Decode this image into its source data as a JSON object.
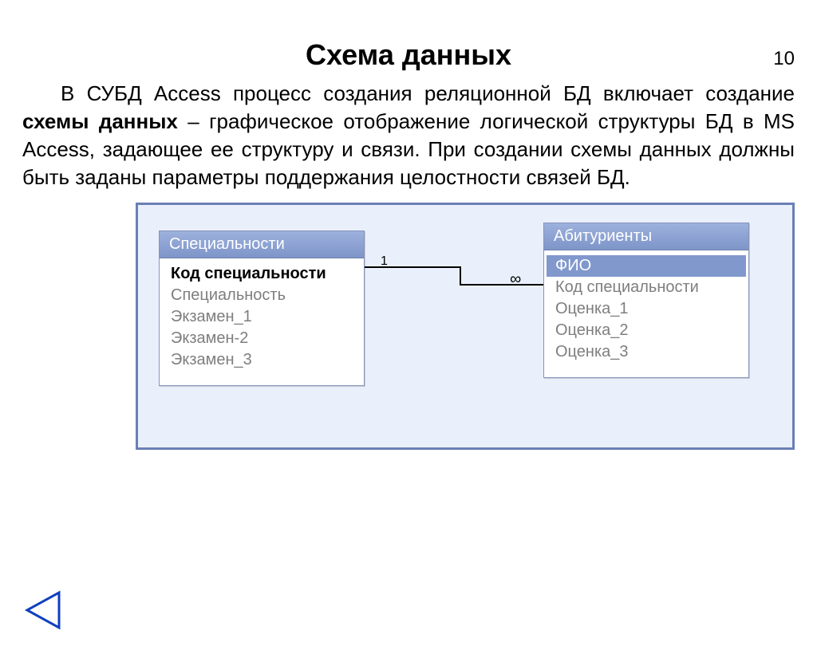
{
  "page_number": "10",
  "title": "Схема данных",
  "paragraph_pre": "В СУБД Access процесс создания реляционной БД включает создание ",
  "paragraph_bold": "схемы данных",
  "paragraph_post": " – графическое отображение логической структуры БД в MS Access, задающее ее структуру и связи. При создании схемы данных должны быть заданы параметры поддержания целостности связей БД.",
  "tables": {
    "left": {
      "title": "Специальности",
      "fields": [
        {
          "label": "Код специальности",
          "pk": true
        },
        {
          "label": "Специальность"
        },
        {
          "label": "Экзамен_1"
        },
        {
          "label": "Экзамен-2"
        },
        {
          "label": "Экзамен_3"
        }
      ]
    },
    "right": {
      "title": "Абитуриенты",
      "fields": [
        {
          "label": "ФИО",
          "selected": true
        },
        {
          "label": "Код специальности"
        },
        {
          "label": "Оценка_1"
        },
        {
          "label": "Оценка_2"
        },
        {
          "label": "Оценка_3"
        }
      ]
    }
  },
  "relation": {
    "one": "1",
    "many": "∞"
  }
}
